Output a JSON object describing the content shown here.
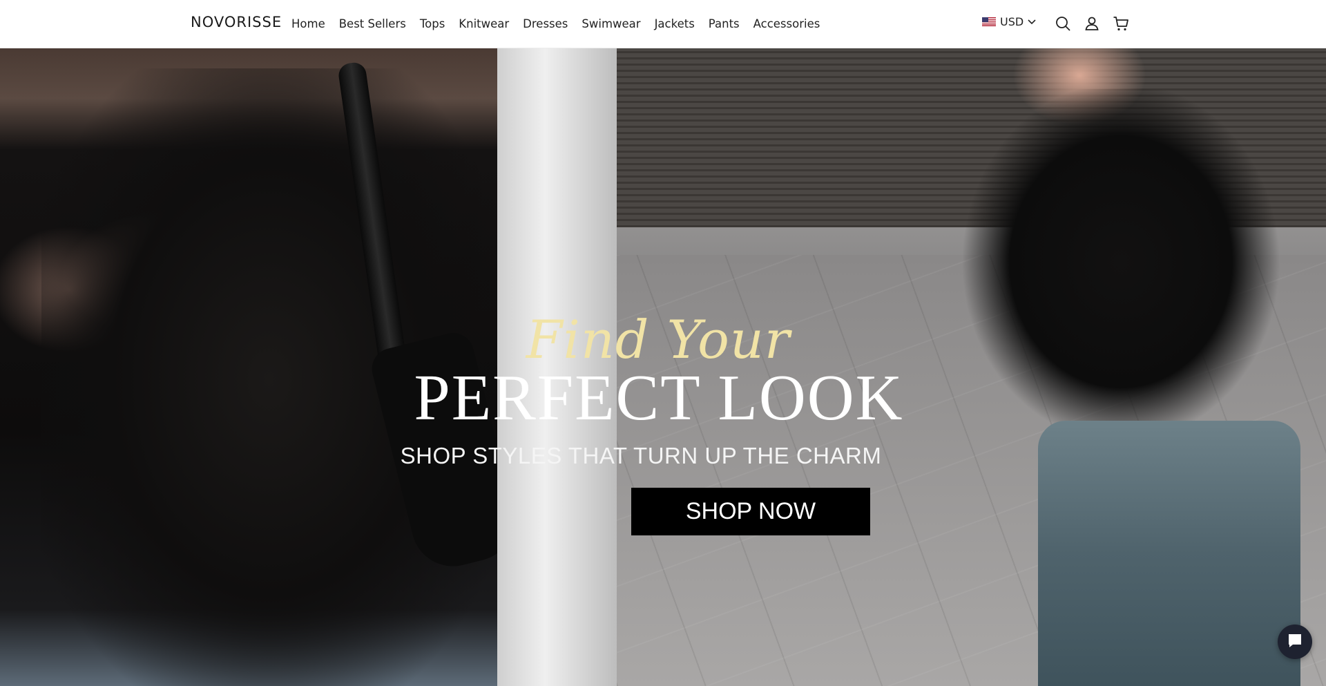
{
  "header": {
    "logo": "NOVORISSE",
    "nav": [
      "Home",
      "Best Sellers",
      "Tops",
      "Knitwear",
      "Dresses",
      "Swimwear",
      "Jackets",
      "Pants",
      "Accessories"
    ],
    "currency": "USD",
    "icons": [
      "us-flag-icon",
      "chevron-down-icon",
      "search-icon",
      "account-icon",
      "cart-icon"
    ]
  },
  "hero": {
    "script_text": "Find Your",
    "headline": "PERFECT LOOK",
    "subline": "SHOP STYLES THAT TURN UP THE CHARM",
    "button": "SHOP NOW"
  },
  "chat": {
    "icon": "chat-icon"
  },
  "colors": {
    "script_text": "#f1e3a6",
    "button_bg": "#000000",
    "chat_bg": "#1e2230"
  }
}
